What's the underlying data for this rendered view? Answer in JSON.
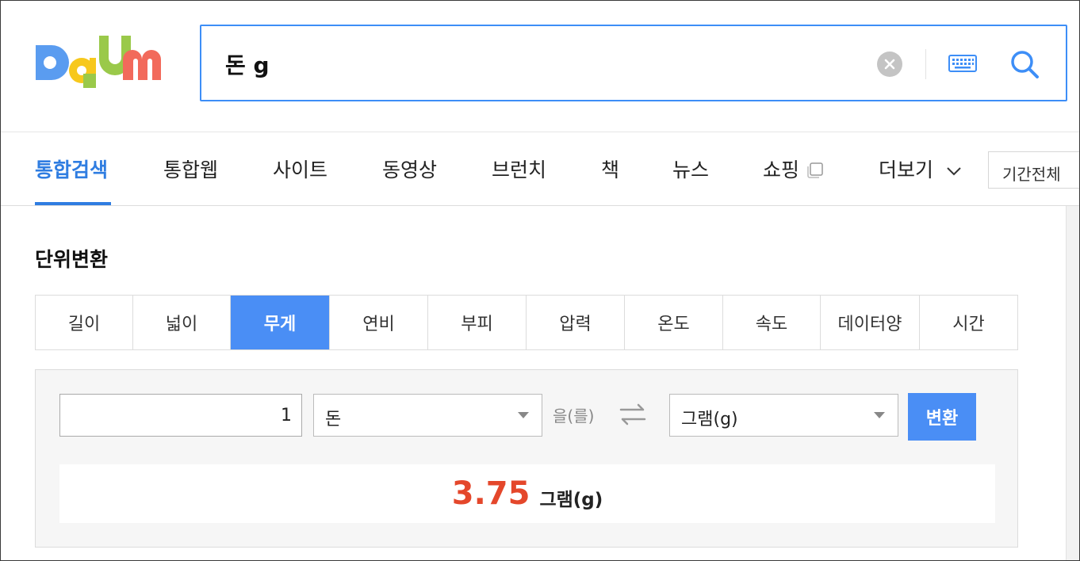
{
  "search": {
    "query": "돈 g"
  },
  "tabs": [
    {
      "label": "통합검색",
      "active": true
    },
    {
      "label": "통합웹"
    },
    {
      "label": "사이트"
    },
    {
      "label": "동영상"
    },
    {
      "label": "브런치"
    },
    {
      "label": "책"
    },
    {
      "label": "뉴스"
    },
    {
      "label": "쇼핑"
    },
    {
      "label": "더보기"
    }
  ],
  "period_filter": "기간전체",
  "section_title": "단위변환",
  "unit_tabs": [
    "길이",
    "넓이",
    "무게",
    "연비",
    "부피",
    "압력",
    "온도",
    "속도",
    "데이터양",
    "시간"
  ],
  "active_unit_tab": "무게",
  "converter": {
    "input_value": "1",
    "from_unit": "돈",
    "connector": "을(를)",
    "to_unit": "그램(g)",
    "convert_label": "변환",
    "result_value": "3.75",
    "result_unit": "그램(g)"
  },
  "colors": {
    "accent": "#2f7de1",
    "active_tab_bg": "#4a8ef5",
    "result": "#e4472b",
    "logo_d": "#5a9cf0",
    "logo_a": "#f7c81c",
    "logo_u": "#9ac94a",
    "logo_m": "#f26a5b"
  },
  "icons": {
    "logo": "daum-logo",
    "clear": "clear-icon",
    "keyboard": "keyboard-icon",
    "search": "search-icon",
    "shopping": "new-window-icon",
    "more": "chevron-down-icon",
    "swap": "swap-arrows-icon"
  }
}
